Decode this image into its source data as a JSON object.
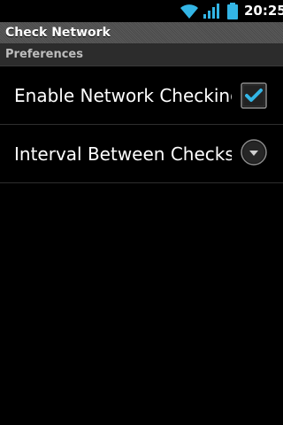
{
  "status_bar": {
    "time": "20:25",
    "icons": [
      "wifi-icon",
      "signal-icon",
      "battery-icon"
    ]
  },
  "title_bar": {
    "title": "Check Network"
  },
  "preferences": {
    "category": "Preferences",
    "items": [
      {
        "title": "Enable Network Checking",
        "widget": "checkbox",
        "checked": true
      },
      {
        "title": "Interval Between Checks",
        "widget": "dropdown",
        "icon": "chevron-down-icon"
      }
    ]
  },
  "colors": {
    "accent": "#33b5e5",
    "background": "#000000",
    "category_bg": "#2c2c2c"
  }
}
